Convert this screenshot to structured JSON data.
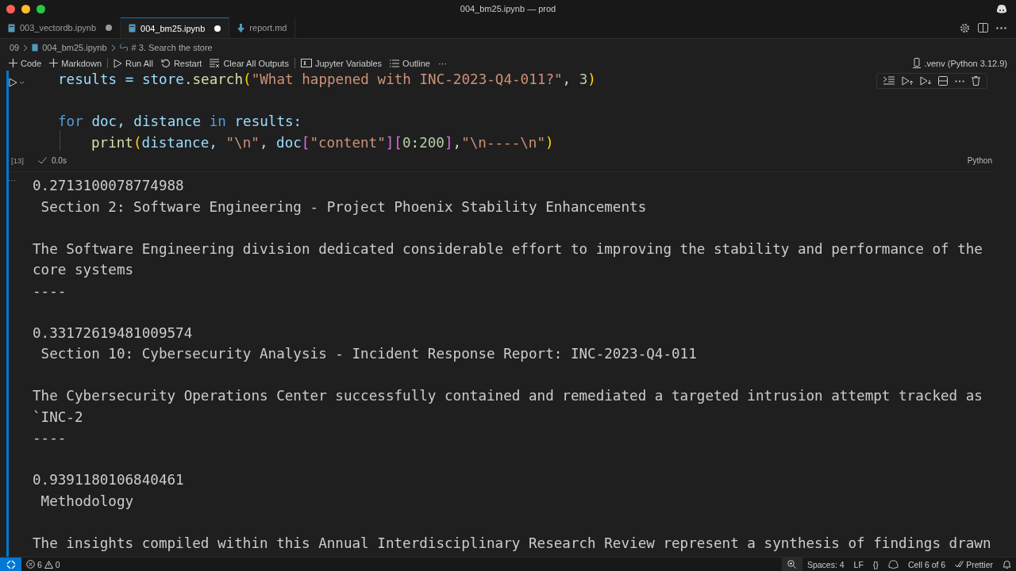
{
  "window": {
    "title": "004_bm25.ipynb — prod"
  },
  "tabs": [
    {
      "label": "003_vectordb.ipynb",
      "selected": false,
      "kind": "notebook",
      "modified": true
    },
    {
      "label": "004_bm25.ipynb",
      "selected": true,
      "kind": "notebook",
      "modified": true
    },
    {
      "label": "report.md",
      "selected": false,
      "kind": "markdown",
      "modified": false
    }
  ],
  "breadcrumb": [
    "09",
    "004_bm25.ipynb",
    "# 3. Search the store"
  ],
  "toolbar": {
    "items": [
      {
        "label": "Code",
        "kind": "plus"
      },
      {
        "label": "Markdown",
        "kind": "plus"
      },
      {
        "label": "Run All",
        "kind": "run"
      },
      {
        "label": "Restart",
        "kind": "restart"
      },
      {
        "label": "Clear All Outputs",
        "kind": "clear"
      },
      {
        "label": "Jupyter Variables",
        "kind": "variables"
      },
      {
        "label": "Outline",
        "kind": "outline"
      }
    ],
    "more": "···",
    "kernel": ".venv (Python 3.12.9)"
  },
  "cell": {
    "execution_count": "[13]",
    "status": "0.0s",
    "language": "Python",
    "blocks": [
      {
        "lines": [
          {
            "tokens": [
              {
                "t": "results = ",
                "kind": "var"
              },
              {
                "t": "store.",
                "kind": "var"
              },
              {
                "t": "search",
                "kind": "func"
              },
              {
                "t": "(",
                "kind": "paren"
              },
              {
                "t": "\"What happened with INC-2023-Q4-011?\"",
                "kind": "str"
              },
              {
                "t": ", ",
                "kind": "plain"
              },
              {
                "t": "3",
                "kind": "num"
              },
              {
                "t": ")",
                "kind": "paren"
              }
            ]
          }
        ]
      },
      {
        "lines": [
          {
            "tokens": [
              {
                "t": "for ",
                "kind": "kw"
              },
              {
                "t": "doc, distance ",
                "kind": "var"
              },
              {
                "t": "in ",
                "kind": "kw"
              },
              {
                "t": "results:",
                "kind": "var"
              }
            ],
            "children": [
              {
                "tokens": [
                  {
                    "t": "print",
                    "kind": "func"
                  },
                  {
                    "t": "(",
                    "kind": "paren"
                  },
                  {
                    "t": "distance, ",
                    "kind": "var"
                  },
                  {
                    "t": "\"\\n\"",
                    "kind": "str"
                  },
                  {
                    "t": ", ",
                    "kind": "plain"
                  },
                  {
                    "t": "doc",
                    "kind": "var"
                  },
                  {
                    "t": "[",
                    "kind": "paren2"
                  },
                  {
                    "t": "\"content\"",
                    "kind": "str"
                  },
                  {
                    "t": "][",
                    "kind": "paren2"
                  },
                  {
                    "t": "0",
                    "kind": "num"
                  },
                  {
                    "t": ":",
                    "kind": "plain"
                  },
                  {
                    "t": "200",
                    "kind": "num"
                  },
                  {
                    "t": "]",
                    "kind": "paren2"
                  },
                  {
                    "t": ",",
                    "kind": "plain"
                  },
                  {
                    "t": "\"\\n----\\n\"",
                    "kind": "str"
                  },
                  {
                    "t": ")",
                    "kind": "paren"
                  }
                ]
              }
            ]
          }
        ]
      }
    ]
  },
  "output_more": "···",
  "output": [
    {
      "distance": "0.2713100078774988",
      "heading": " Section 2: Software Engineering - Project Phoenix Stability Enhancements",
      "body": [
        "The Software Engineering division dedicated considerable effort to improving the stability and performance of the",
        "core systems"
      ],
      "separator": "----"
    },
    {
      "distance": "0.33172619481009574",
      "heading": " Section 10: Cybersecurity Analysis - Incident Response Report: INC-2023-Q4-011",
      "body": [
        "The Cybersecurity Operations Center successfully contained and remediated a targeted intrusion attempt tracked as",
        "`INC-2"
      ],
      "separator": "----"
    },
    {
      "distance": "0.9391180106840461",
      "heading": " Methodology",
      "body": [
        "The insights compiled within this Annual Interdisciplinary Research Review represent a synthesis of findings drawn"
      ]
    }
  ],
  "status_bar": {
    "errors": "6",
    "warnings": "0",
    "right": [
      "Spaces: 4",
      "LF",
      "{}"
    ],
    "cell": "Cell 6 of 6",
    "formatter": "Prettier"
  }
}
